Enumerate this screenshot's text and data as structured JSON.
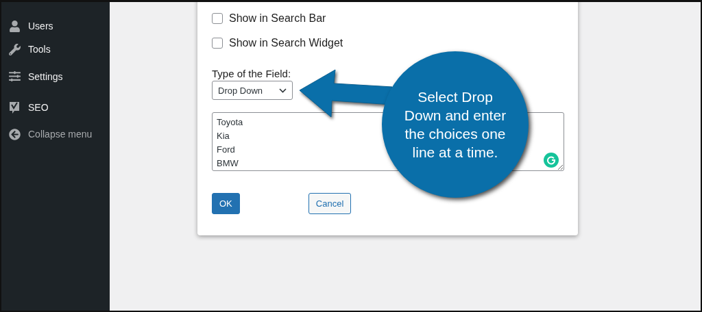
{
  "sidebar": {
    "items": [
      {
        "label": "Users"
      },
      {
        "label": "Tools"
      },
      {
        "label": "Settings"
      },
      {
        "label": "SEO"
      },
      {
        "label": "Collapse menu"
      }
    ]
  },
  "dialog": {
    "checkboxes": [
      {
        "label": "Show in Search Bar",
        "checked": false
      },
      {
        "label": "Show in Search Widget",
        "checked": false
      }
    ],
    "field_type_label": "Type of the Field:",
    "field_type": {
      "value": "Drop Down"
    },
    "choices": {
      "value": "Toyota\nKia\nFord\nBMW"
    },
    "buttons": [
      {
        "label": "OK",
        "kind": "primary"
      },
      {
        "label": "Cancel",
        "kind": "secondary"
      }
    ]
  },
  "callout": {
    "text": "Select Drop Down and enter the choices one line at a time."
  }
}
